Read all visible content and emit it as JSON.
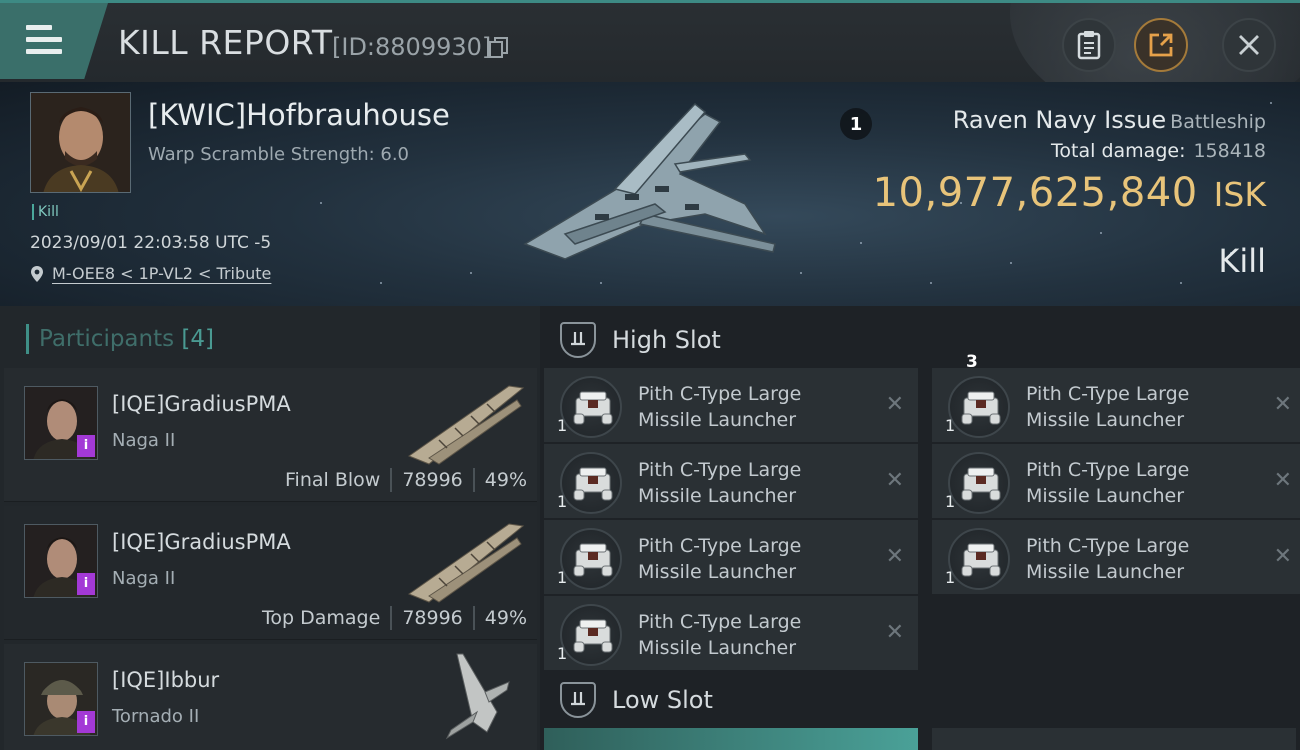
{
  "header": {
    "title": "KILL REPORT",
    "report_id": "[ID:8809930]",
    "icons": [
      "menu-icon",
      "copy-icon",
      "clipboard-icon",
      "share-icon",
      "close-icon"
    ]
  },
  "victim": {
    "name": "[KWIC]Hofbrauhouse",
    "warp_scramble": "Warp Scramble Strength: 6.0",
    "tag": "Kill",
    "timestamp": "2023/09/01 22:03:58 UTC -5",
    "location": "M-OEE8 < 1P-VL2 < Tribute",
    "badge": "1",
    "ship_name": "Raven Navy Issue",
    "ship_class": "Battleship",
    "total_damage_label": "Total damage:",
    "total_damage": "158418",
    "isk_value": "10,977,625,840",
    "isk_unit": "ISK",
    "result": "Kill"
  },
  "participants": {
    "label": "Participants",
    "count": "[4]",
    "items": [
      {
        "name": "[IQE]GradiusPMA",
        "ship": "Naga II",
        "role": "Final Blow",
        "damage": "78996",
        "percent": "49%",
        "badge": "i"
      },
      {
        "name": "[IQE]GradiusPMA",
        "ship": "Naga II",
        "role": "Top Damage",
        "damage": "78996",
        "percent": "49%",
        "badge": "i"
      },
      {
        "name": "[IQE]Ibbur",
        "ship": "Tornado II",
        "badge": "i"
      }
    ]
  },
  "slots": {
    "high": {
      "title": "High Slot",
      "marker": "3",
      "modules": [
        {
          "line1": "Pith C-Type Large",
          "line2": "Missile Launcher",
          "qty": "1"
        },
        {
          "line1": "Pith C-Type Large",
          "line2": "Missile Launcher",
          "qty": "1"
        },
        {
          "line1": "Pith C-Type Large",
          "line2": "Missile Launcher",
          "qty": "1"
        },
        {
          "line1": "Pith C-Type Large",
          "line2": "Missile Launcher",
          "qty": "1"
        },
        {
          "line1": "Pith C-Type Large",
          "line2": "Missile Launcher",
          "qty": "1"
        },
        {
          "line1": "Pith C-Type Large",
          "line2": "Missile Launcher",
          "qty": "1"
        },
        {
          "line1": "Pith C-Type Large",
          "line2": "Missile Launcher",
          "qty": "1"
        }
      ],
      "close_glyph": "✕"
    },
    "low": {
      "title": "Low Slot"
    }
  },
  "colors": {
    "accent": "#3f8f87",
    "isk": "#e8c47a",
    "corp_badge": "#a339d6"
  }
}
